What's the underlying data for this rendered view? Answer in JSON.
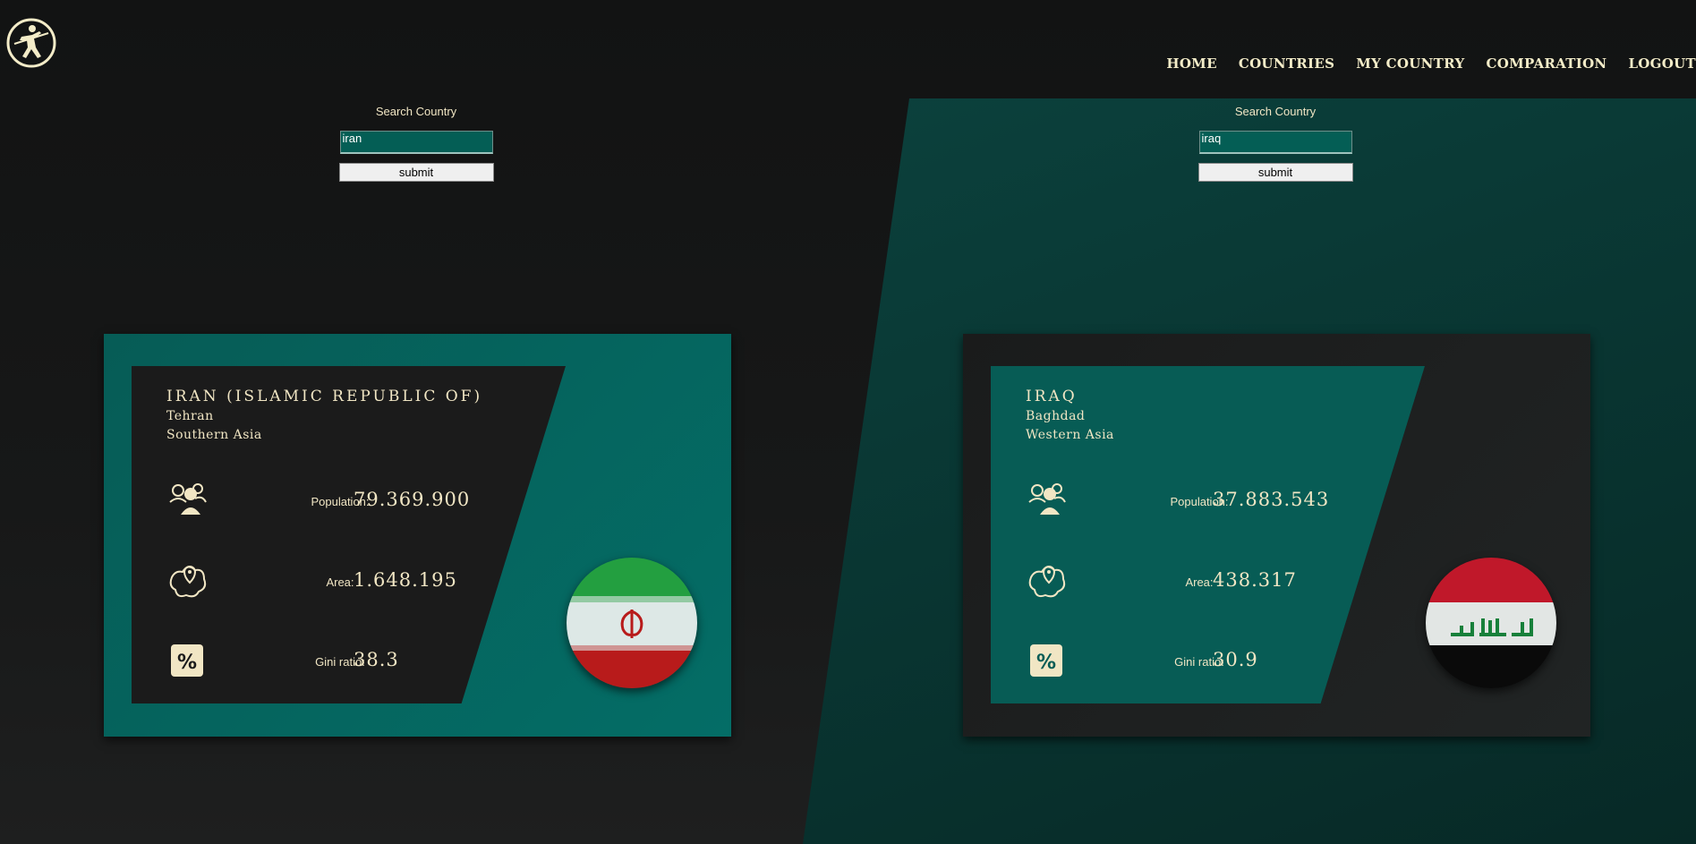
{
  "nav": [
    "HOME",
    "COUNTRIES",
    "MY COUNTRY",
    "COMPARATION",
    "LOGOUT"
  ],
  "search_label": "Search Country",
  "submit_label": "submit",
  "left": {
    "search_value": "iran",
    "name": "IRAN (ISLAMIC REPUBLIC OF)",
    "capital": "Tehran",
    "region": "Southern Asia",
    "population_label": "Population:",
    "population": "79.369.900",
    "area_label": "Area:",
    "area": "1.648.195",
    "gini_label": "Gini ratio:",
    "gini": "38.3",
    "flag_icon": "iran-flag"
  },
  "right": {
    "search_value": "iraq",
    "name": "IRAQ",
    "capital": "Baghdad",
    "region": "Western Asia",
    "population_label": "Population:",
    "population": "37.883.543",
    "area_label": "Area:",
    "area": "438.317",
    "gini_label": "Gini ratio:",
    "gini": "30.9",
    "flag_icon": "iraq-flag"
  },
  "colors": {
    "accent_text": "#f1e6c4",
    "teal": "#046d66",
    "dark": "#1b1b1b"
  }
}
